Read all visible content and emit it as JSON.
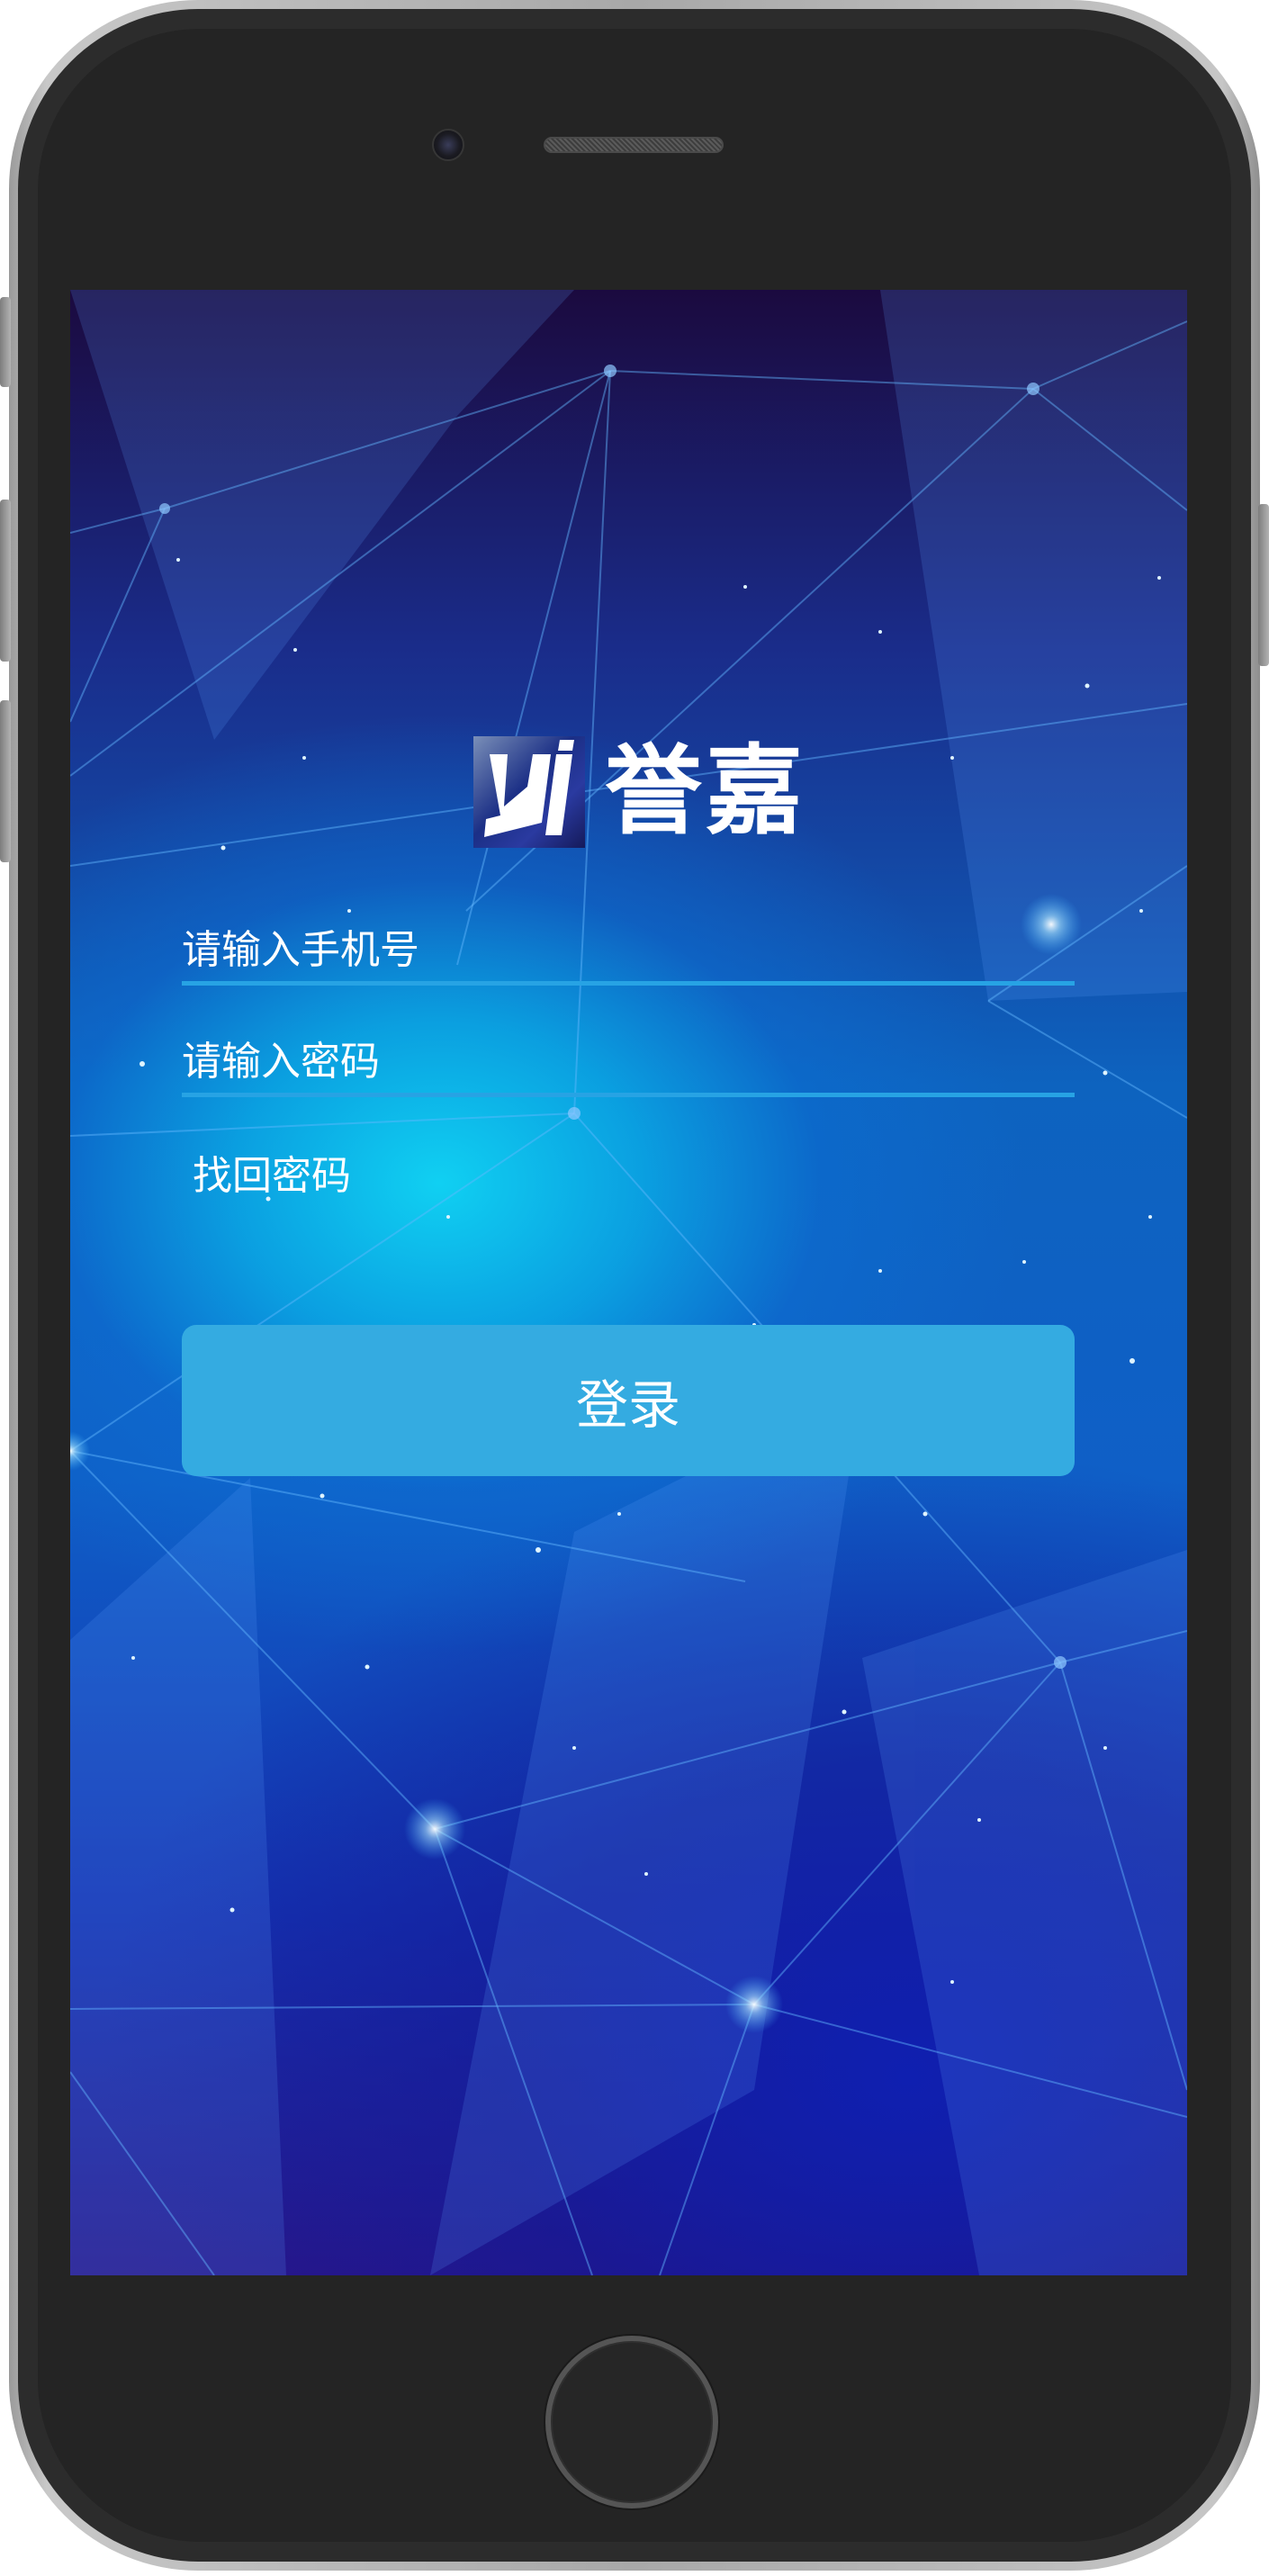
{
  "colors": {
    "accent": "#34abe1",
    "field_underline": "#27a3e4",
    "text": "#ffffff",
    "phone_bezel": "#242424"
  },
  "logo": {
    "icon": "yj-logo-icon",
    "brand_text": "誉嘉"
  },
  "form": {
    "phone_placeholder": "请输入手机号",
    "phone_value": "",
    "password_placeholder": "请输入密码",
    "password_value": "",
    "forgot_password_label": "找回密码",
    "login_label": "登录"
  }
}
